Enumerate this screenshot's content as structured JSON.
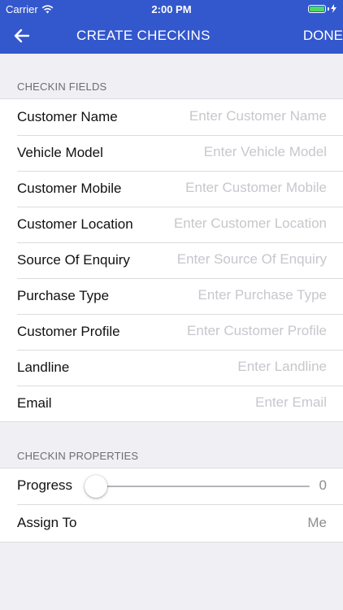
{
  "status_bar": {
    "carrier": "Carrier",
    "time": "2:00 PM"
  },
  "nav": {
    "title": "CREATE CHECKINS",
    "done_label": "DONE"
  },
  "sections": {
    "fields_title": "CHECKIN FIELDS",
    "properties_title": "CHECKIN PROPERTIES"
  },
  "fields": [
    {
      "label": "Customer Name",
      "placeholder": "Enter Customer Name"
    },
    {
      "label": "Vehicle Model",
      "placeholder": "Enter Vehicle Model"
    },
    {
      "label": "Customer Mobile",
      "placeholder": "Enter Customer Mobile"
    },
    {
      "label": "Customer Location",
      "placeholder": "Enter Customer Location"
    },
    {
      "label": "Source Of Enquiry",
      "placeholder": "Enter Source Of Enquiry"
    },
    {
      "label": "Purchase Type",
      "placeholder": "Enter Purchase Type"
    },
    {
      "label": "Customer Profile",
      "placeholder": "Enter Customer Profile"
    },
    {
      "label": "Landline",
      "placeholder": "Enter Landline"
    },
    {
      "label": "Email",
      "placeholder": "Enter Email"
    }
  ],
  "properties": {
    "progress": {
      "label": "Progress",
      "value": "0",
      "fraction": 0
    },
    "assign_to": {
      "label": "Assign To",
      "value": "Me"
    }
  },
  "colors": {
    "header_bg": "#3357cc",
    "battery": "#4cd964",
    "placeholder": "#c7c7cd"
  }
}
